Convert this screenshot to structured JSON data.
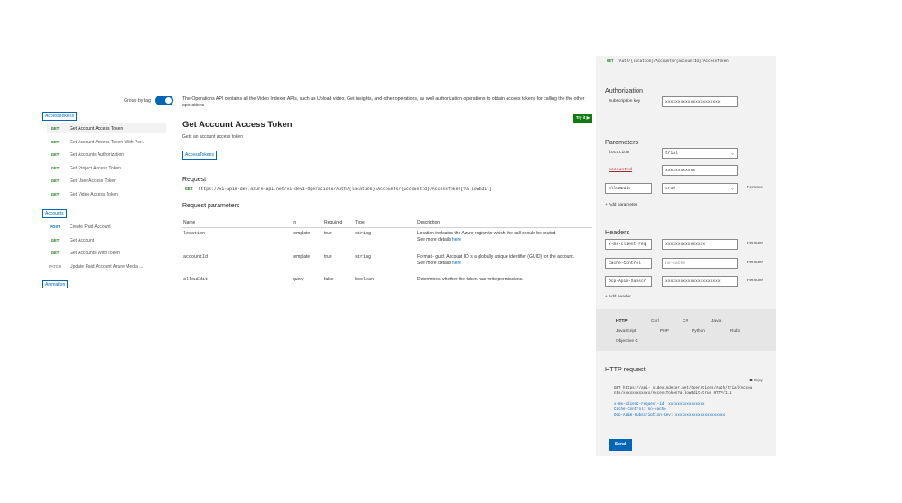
{
  "sidebar": {
    "group_by_tag_label": "Group by tag",
    "tags": [
      {
        "label": "AccessTokens",
        "operations": [
          {
            "verb": "GET",
            "name": "Get Account Access Token"
          },
          {
            "verb": "GET",
            "name": "Get Account Access Token With Per..."
          },
          {
            "verb": "GET",
            "name": "Get Accounts Authorization"
          },
          {
            "verb": "GET",
            "name": "Get Project Access Token"
          },
          {
            "verb": "GET",
            "name": "Get User Access Token"
          },
          {
            "verb": "GET",
            "name": "Get Video Access Token"
          }
        ]
      },
      {
        "label": "Accounts",
        "operations": [
          {
            "verb": "POST",
            "name": "Create Paid Account"
          },
          {
            "verb": "GET",
            "name": "Get Account"
          },
          {
            "verb": "GET",
            "name": "Get Accounts With Token"
          },
          {
            "verb": "PATCH",
            "name": "Update Paid Account Azure Media ..."
          }
        ]
      },
      {
        "label": "Animation"
      }
    ]
  },
  "main": {
    "intro": "The Operations API contains all the Video Indexer APIs, such as Upload video, Get insights, and other operations, as well authorization operations to obtain access tokens for calling the the other operations",
    "try_it_label": "Try it",
    "title": "Get Account Access Token",
    "description": "Gets an account access token",
    "tag": "AccessTokens",
    "request_heading": "Request",
    "request_verb": "GET",
    "request_url": "https://vi-apim-dev.azure-api.net/vi-dev1-Operations/Auth/{location}/Accounts/{accountId}/AccessToken[?allowEdit]",
    "params_heading": "Request parameters",
    "params_columns": [
      "Name",
      "In",
      "Required",
      "Type",
      "Description"
    ],
    "params": [
      {
        "name": "location",
        "in": "template",
        "required": "true",
        "type": "string",
        "description": "Location indicates the Azure region to which the call should be routed",
        "more": "See more details",
        "more_link": "here"
      },
      {
        "name": "accountId",
        "in": "template",
        "required": "true",
        "type": "string",
        "description": "Format - guid. Account ID is a globally unique identifier (GUID) for the account.",
        "more": "See more details",
        "more_link": "here"
      },
      {
        "name": "allowEdit",
        "in": "query",
        "required": "false",
        "type": "boolean",
        "description": "Determines whether the token has write permissions."
      }
    ]
  },
  "panel": {
    "top_verb": "GET",
    "top_url": "/Auth/{location}/Accounts/{accountId}/AccessToken",
    "authorization_heading": "Authorization",
    "subscription_key_label": "Subscription key",
    "subscription_key_value": "xxxxxxxxxxxxxxxxxxxxxx",
    "parameters_heading": "Parameters",
    "location_label": "location",
    "location_value": "trial",
    "accountId_label": "accountId",
    "accountId_value": "xxxxxxxxxxxx",
    "allowEdit_name": "allowEdit",
    "allowEdit_value": "true",
    "remove_label": "Remove",
    "add_parameter": "+ Add parameter",
    "headers_heading": "Headers",
    "headers": [
      {
        "name": "x-ms-client-req",
        "value": "xxxxxxxxxxxxxxxx",
        "placeholder": false
      },
      {
        "name": "Cache-Control",
        "value": "no-cache",
        "placeholder": true
      },
      {
        "name": "Ocp-Apim-Subscr",
        "value": "xxxxxxxxxxxxxxxxxxxxxx",
        "placeholder": false
      }
    ],
    "add_header": "+ Add header",
    "languages": [
      "HTTP",
      "Curl",
      "C#",
      "Java",
      "JavaScript",
      "PHP",
      "Python",
      "Ruby",
      "Objective C"
    ],
    "http_request_heading": "HTTP request",
    "copy_label": "Copy",
    "http_line1": "GET https://api- videoindexer.net/Operations/Auth/trial/Accou",
    "http_line2": "nts/xxxxxxxxxxxx/AccessToken?allowEdit=true HTTP/1.1",
    "http_header1": "x-ms-client-request-id: xxxxxxxxxxxxxxxx",
    "http_header2": "Cache-Control: no-cache",
    "http_header3": "Ocp-Apim-Subscription-Key: xxxxxxxxxxxxxxxxxxxxxx",
    "send_label": "Send"
  },
  "colors": {
    "accent": "#0067b8",
    "get_verb": "#107c10",
    "required": "#a4262c",
    "panel_bg": "#f2f2f2"
  }
}
